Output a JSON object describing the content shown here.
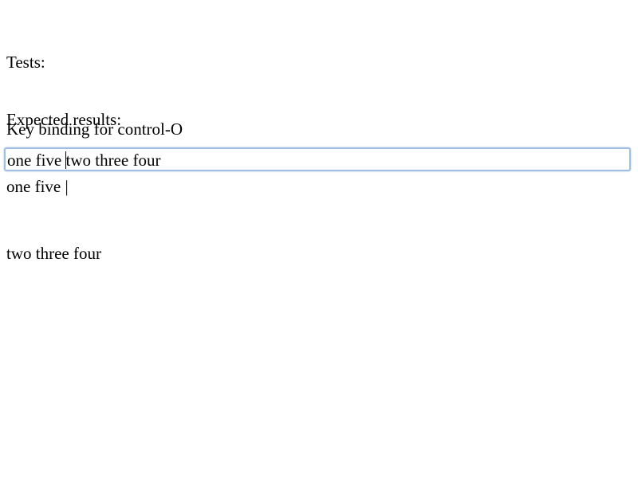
{
  "tests": {
    "heading": "Tests:",
    "description": "Key binding for control-O"
  },
  "expected": {
    "heading": "Expected results:",
    "line1": "one five |",
    "line2": "two three four"
  },
  "editor": {
    "text_before_caret": "one five ",
    "text_after_caret": "two three four",
    "accent_color": "#9fc0e2"
  }
}
